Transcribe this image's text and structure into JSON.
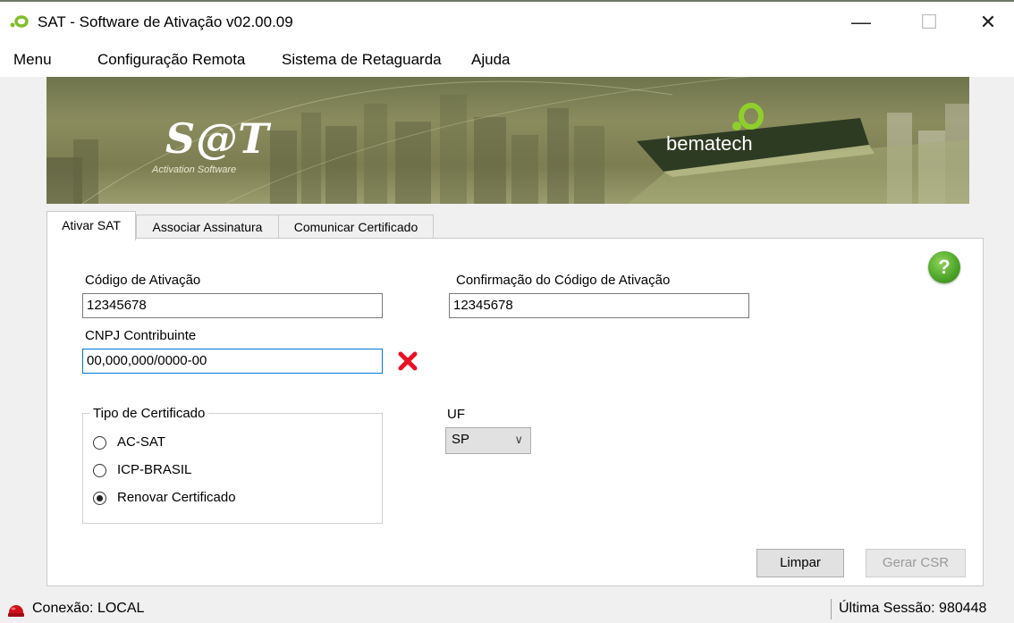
{
  "window": {
    "title": "SAT - Software de Ativação v02.00.09"
  },
  "menu": {
    "items": [
      "Menu",
      "Configuração Remota",
      "Sistema de Retaguarda",
      "Ajuda"
    ]
  },
  "banner": {
    "logo_text": "S@T",
    "logo_subtitle": "Activation Software",
    "brand": "bematech"
  },
  "tabs": [
    "Ativar SAT",
    "Associar Assinatura",
    "Comunicar Certificado"
  ],
  "form": {
    "codigo_label": "Código de Ativação",
    "codigo_value": "12345678",
    "confirmacao_label": "Confirmação do Código de Ativação",
    "confirmacao_value": "12345678",
    "cnpj_label": "CNPJ Contribuinte",
    "cnpj_value": "00,000,000/0000-00",
    "tipo_label": "Tipo de Certificado",
    "tipo_options": [
      "AC-SAT",
      "ICP-BRASIL",
      "Renovar Certificado"
    ],
    "tipo_selected": "Renovar Certificado",
    "uf_label": "UF",
    "uf_value": "SP",
    "help_glyph": "?"
  },
  "buttons": {
    "limpar": "Limpar",
    "gerar_csr": "Gerar CSR"
  },
  "status": {
    "conexao": "Conexão: LOCAL",
    "ultima_sessao": "Última Sessão: 980448"
  },
  "colors": {
    "accent": "#0078d7",
    "help_green": "#4fa82a",
    "error_red": "#e81123",
    "status_red": "#d0101a"
  },
  "icons": {
    "app": "sat-app-icon",
    "help": "help-icon",
    "error": "error-x-icon",
    "status": "connection-status-icon"
  }
}
